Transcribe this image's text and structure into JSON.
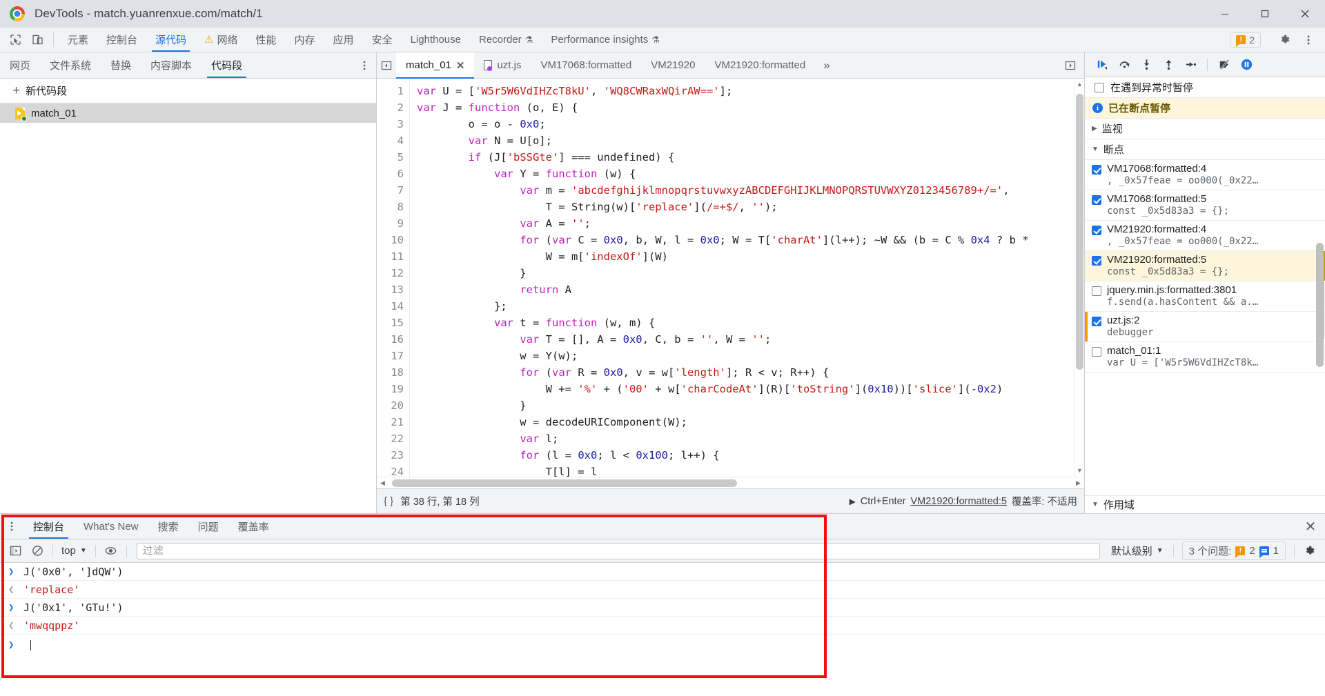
{
  "window": {
    "title": "DevTools - match.yuanrenxue.com/match/1",
    "minimize": "minimize-button",
    "maximize": "maximize-button",
    "close": "close-button"
  },
  "main_toolbar": {
    "inspect_icon": "inspect-element-icon",
    "device_icon": "device-toolbar-icon",
    "tabs": [
      {
        "label": "元素",
        "selected": false,
        "warn": false
      },
      {
        "label": "控制台",
        "selected": false,
        "warn": false
      },
      {
        "label": "源代码",
        "selected": true,
        "warn": false
      },
      {
        "label": "网络",
        "selected": false,
        "warn": true
      },
      {
        "label": "性能",
        "selected": false,
        "warn": false
      },
      {
        "label": "内存",
        "selected": false,
        "warn": false
      },
      {
        "label": "应用",
        "selected": false,
        "warn": false
      },
      {
        "label": "安全",
        "selected": false,
        "warn": false
      },
      {
        "label": "Lighthouse",
        "selected": false,
        "warn": false
      },
      {
        "label": "Recorder",
        "selected": false,
        "warn": false,
        "flask": true
      },
      {
        "label": "Performance insights",
        "selected": false,
        "warn": false,
        "flask": true
      }
    ],
    "issue_count": "2",
    "settings_icon": "gear-icon",
    "more_icon": "more-vertical-icon"
  },
  "navigator": {
    "tabs": [
      {
        "label": "网页",
        "selected": false
      },
      {
        "label": "文件系统",
        "selected": false
      },
      {
        "label": "替换",
        "selected": false
      },
      {
        "label": "内容脚本",
        "selected": false
      },
      {
        "label": "代码段",
        "selected": true
      }
    ],
    "more_icon": "more-vertical-icon",
    "new_snippet": "新代码段",
    "items": [
      {
        "label": "match_01",
        "selected": true
      }
    ]
  },
  "editor": {
    "prev_icon": "previous-tab-icon",
    "next_icon": "next-tab-icon",
    "tabs": [
      {
        "label": "match_01",
        "selected": true,
        "closable": true,
        "icon": "snippet-icon"
      },
      {
        "label": "uzt.js",
        "selected": false,
        "closable": false,
        "icon": "js-file-icon"
      },
      {
        "label": "VM17068:formatted",
        "selected": false,
        "closable": false
      },
      {
        "label": "VM21920",
        "selected": false,
        "closable": false
      },
      {
        "label": "VM21920:formatted",
        "selected": false,
        "closable": false
      }
    ],
    "overflow_icon": "chevron-double-right-icon",
    "lines": [
      {
        "n": "1",
        "html": "<span class=\"kw\">var</span> U = [<span class=\"str\">'W5r5W6VdIHZcT8kU'</span>, <span class=\"str\">'WQ8CWRaxWQirAW=='</span>];"
      },
      {
        "n": "2",
        "html": "<span class=\"kw\">var</span> J = <span class=\"kw\">function</span> (o, E) {"
      },
      {
        "n": "3",
        "html": "        o = o - <span class=\"num\">0x0</span>;"
      },
      {
        "n": "4",
        "html": "        <span class=\"kw\">var</span> N = U[o];"
      },
      {
        "n": "5",
        "html": "        <span class=\"kw\">if</span> (J[<span class=\"str\">'bSSGte'</span>] === undefined) {"
      },
      {
        "n": "6",
        "html": "            <span class=\"kw\">var</span> Y = <span class=\"kw\">function</span> (w) {"
      },
      {
        "n": "7",
        "html": "                <span class=\"kw\">var</span> m = <span class=\"str\">'abcdefghijklmnopqrstuvwxyzABCDEFGHIJKLMNOPQRSTUVWXYZ0123456789+/='</span>,"
      },
      {
        "n": "8",
        "html": "                    T = String(w)[<span class=\"str\">'replace'</span>](<span class=\"str\">/=+$/</span>, <span class=\"str\">''</span>);"
      },
      {
        "n": "9",
        "html": "                <span class=\"kw\">var</span> A = <span class=\"str\">''</span>;"
      },
      {
        "n": "10",
        "html": "                <span class=\"kw\">for</span> (<span class=\"kw\">var</span> C = <span class=\"num\">0x0</span>, b, W, l = <span class=\"num\">0x0</span>; W = T[<span class=\"str\">'charAt'</span>](l++); ~W &amp;&amp; (b = C % <span class=\"num\">0x4</span> ? b *"
      },
      {
        "n": "11",
        "html": "                    W = m[<span class=\"str\">'indexOf'</span>](W)"
      },
      {
        "n": "12",
        "html": "                }"
      },
      {
        "n": "13",
        "html": "                <span class=\"kw\">return</span> A"
      },
      {
        "n": "14",
        "html": "            };"
      },
      {
        "n": "15",
        "html": "            <span class=\"kw\">var</span> t = <span class=\"kw\">function</span> (w, m) {"
      },
      {
        "n": "16",
        "html": "                <span class=\"kw\">var</span> T = [], A = <span class=\"num\">0x0</span>, C, b = <span class=\"str\">''</span>, W = <span class=\"str\">''</span>;"
      },
      {
        "n": "17",
        "html": "                w = Y(w);"
      },
      {
        "n": "18",
        "html": "                <span class=\"kw\">for</span> (<span class=\"kw\">var</span> R = <span class=\"num\">0x0</span>, v = w[<span class=\"str\">'length'</span>]; R &lt; v; R++) {"
      },
      {
        "n": "19",
        "html": "                    W += <span class=\"str\">'%'</span> + (<span class=\"str\">'00'</span> + w[<span class=\"str\">'charCodeAt'</span>](R)[<span class=\"str\">'toString'</span>](<span class=\"num\">0x10</span>))[<span class=\"str\">'slice'</span>](-<span class=\"num\">0x2</span>)"
      },
      {
        "n": "20",
        "html": "                }"
      },
      {
        "n": "21",
        "html": "                w = decodeURIComponent(W);"
      },
      {
        "n": "22",
        "html": "                <span class=\"kw\">var</span> l;"
      },
      {
        "n": "23",
        "html": "                <span class=\"kw\">for</span> (l = <span class=\"num\">0x0</span>; l &lt; <span class=\"num\">0x100</span>; l++) {"
      },
      {
        "n": "24",
        "html": "                    T[l] = l"
      }
    ],
    "status": {
      "pretty_print_icon": "pretty-print-icon",
      "position": "第 38 行, 第 18 列",
      "run_hint": "Ctrl+Enter",
      "run_icon": "play-icon",
      "current_source": "VM21920:formatted:5",
      "coverage": "覆盖率: 不适用"
    }
  },
  "debugger": {
    "controls": [
      {
        "name": "resume-script-icon"
      },
      {
        "name": "step-over-icon"
      },
      {
        "name": "step-into-icon"
      },
      {
        "name": "step-out-icon"
      },
      {
        "name": "step-icon"
      },
      {
        "name": "deactivate-breakpoints-icon"
      },
      {
        "name": "pause-on-exceptions-icon"
      }
    ],
    "pause_on_exceptions": {
      "label": "在遇到异常时暂停",
      "checked": false
    },
    "paused_banner": "已在断点暂停",
    "watch_section": "监视",
    "breakpoints_section": "断点",
    "scope_section": "作用域",
    "breakpoints": [
      {
        "title": "VM17068:formatted:4",
        "code": ", _0x57feae = oo000(_0x22…",
        "checked": true,
        "highlight": false,
        "current": false
      },
      {
        "title": "VM17068:formatted:5",
        "code": "const _0x5d83a3 = {};",
        "checked": true,
        "highlight": false,
        "current": false
      },
      {
        "title": "VM21920:formatted:4",
        "code": ", _0x57feae = oo000(_0x22…",
        "checked": true,
        "highlight": false,
        "current": false
      },
      {
        "title": "VM21920:formatted:5",
        "code": "const _0x5d83a3 = {};",
        "checked": true,
        "highlight": true,
        "current": false
      },
      {
        "title": "jquery.min.js:formatted:3801",
        "code": "f.send(a.hasContent && a.…",
        "checked": false,
        "highlight": false,
        "current": false
      },
      {
        "title": "uzt.js:2",
        "code": "debugger",
        "checked": true,
        "highlight": false,
        "current": true
      },
      {
        "title": "match_01:1",
        "code": "var U = ['W5r5W6VdIHZcT8k…",
        "checked": false,
        "highlight": false,
        "current": false
      }
    ]
  },
  "drawer": {
    "more_icon": "more-vertical-icon",
    "tabs": [
      {
        "label": "控制台",
        "selected": true
      },
      {
        "label": "What's New",
        "selected": false
      },
      {
        "label": "搜索",
        "selected": false
      },
      {
        "label": "问题",
        "selected": false
      },
      {
        "label": "覆盖率",
        "selected": false
      }
    ],
    "close_icon": "close-icon",
    "toolbar": {
      "sidebar_icon": "console-sidebar-icon",
      "clear_icon": "clear-console-icon",
      "context": "top",
      "eye_icon": "live-expression-icon",
      "filter_placeholder": "过滤",
      "filter_value": "",
      "level": "默认级别",
      "issues_text": "3 个问题:",
      "issue_warn_count": "2",
      "issue_info_count": "1",
      "settings_icon": "gear-icon"
    },
    "messages": [
      {
        "kind": "input",
        "text": "J('0x0', ']dQW')"
      },
      {
        "kind": "output",
        "text": "'replace'"
      },
      {
        "kind": "input",
        "text": "J('0x1', 'GTu!')"
      },
      {
        "kind": "output",
        "text": "'mwqqppz'"
      }
    ],
    "prompt": ""
  },
  "colors": {
    "accent": "#1a73e8",
    "warning": "#f29900",
    "highlight": "#fdf6dd",
    "annotation": "#ee1111"
  }
}
